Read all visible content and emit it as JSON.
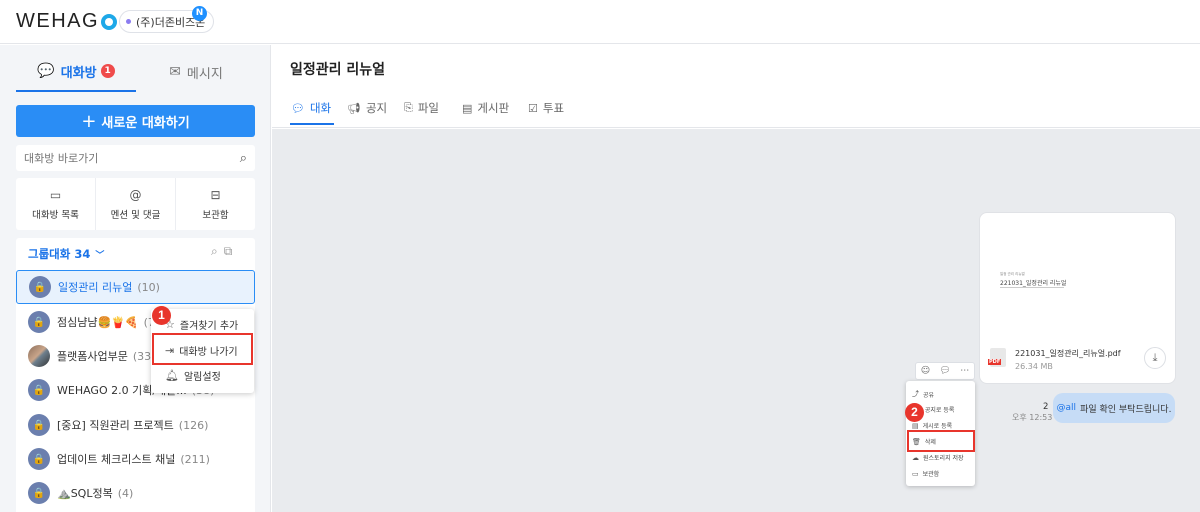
{
  "header": {
    "logo": "WEHAG",
    "company": "(주)더존비즈온",
    "company_badge": "N"
  },
  "sidebar": {
    "tabs": [
      {
        "label": "대화방",
        "count": "1"
      },
      {
        "label": "메시지"
      }
    ],
    "new_chat_label": "새로운 대화하기",
    "search_placeholder": "대화방 바로가기",
    "quick": [
      {
        "label": "대화방 목록",
        "icon": "chat-list-icon"
      },
      {
        "label": "멘션 및 댓글",
        "icon": "mention-icon"
      },
      {
        "label": "보관함",
        "icon": "archive-icon"
      }
    ],
    "group_label": "그룹대화 34",
    "rooms": [
      {
        "name": "일정관리 리뉴얼",
        "count": "(10)",
        "active": true
      },
      {
        "name": "점심냠냠🍔🍟🍕",
        "count": "(7)"
      },
      {
        "name": "플랫폼사업부문",
        "count": "(333)"
      },
      {
        "name": "WEHAGO 2.0 기획/개발...",
        "count": "(38)"
      },
      {
        "name": "[중요] 직원관리 프로젝트",
        "count": "(126)"
      },
      {
        "name": "업데이트 체크리스트 채널",
        "count": "(211)"
      },
      {
        "name": "⛰️SQL정복",
        "count": "(4)"
      }
    ],
    "context_menu": [
      {
        "label": "즐겨찾기 추가",
        "icon": "star-icon"
      },
      {
        "label": "대화방 나가기",
        "icon": "exit-icon"
      },
      {
        "label": "알림설정",
        "icon": "bell-icon"
      }
    ],
    "step1": "1"
  },
  "main": {
    "title": "일정관리 리뉴얼",
    "tabs": [
      {
        "label": "대화",
        "icon": "chat-icon"
      },
      {
        "label": "공지",
        "icon": "megaphone-icon"
      },
      {
        "label": "파일",
        "icon": "clip-icon"
      },
      {
        "label": "게시판",
        "icon": "board-icon"
      },
      {
        "label": "투표",
        "icon": "vote-icon"
      }
    ],
    "file": {
      "preview_small": "일정 관리 리뉴얼",
      "preview_title": "221031_일정관리 리뉴얼",
      "name": "221031_일정관리_리뉴얼.pdf",
      "size": "26.34 MB",
      "type_label": "PDF"
    },
    "message": {
      "mention": "@all",
      "text": "파일 확인 부탁드립니다.",
      "unread": "2",
      "time": "오후 12:53"
    },
    "file_menu": [
      {
        "label": "공유",
        "icon": "share-icon"
      },
      {
        "label": "공지로 등록",
        "icon": "notice-icon"
      },
      {
        "label": "게시로 등록",
        "icon": "post-icon"
      },
      {
        "label": "삭제",
        "icon": "trash-icon"
      },
      {
        "label": "원스토리지 저장",
        "icon": "cloud-icon"
      },
      {
        "label": "보관함",
        "icon": "archive-icon"
      }
    ],
    "step2": "2"
  }
}
